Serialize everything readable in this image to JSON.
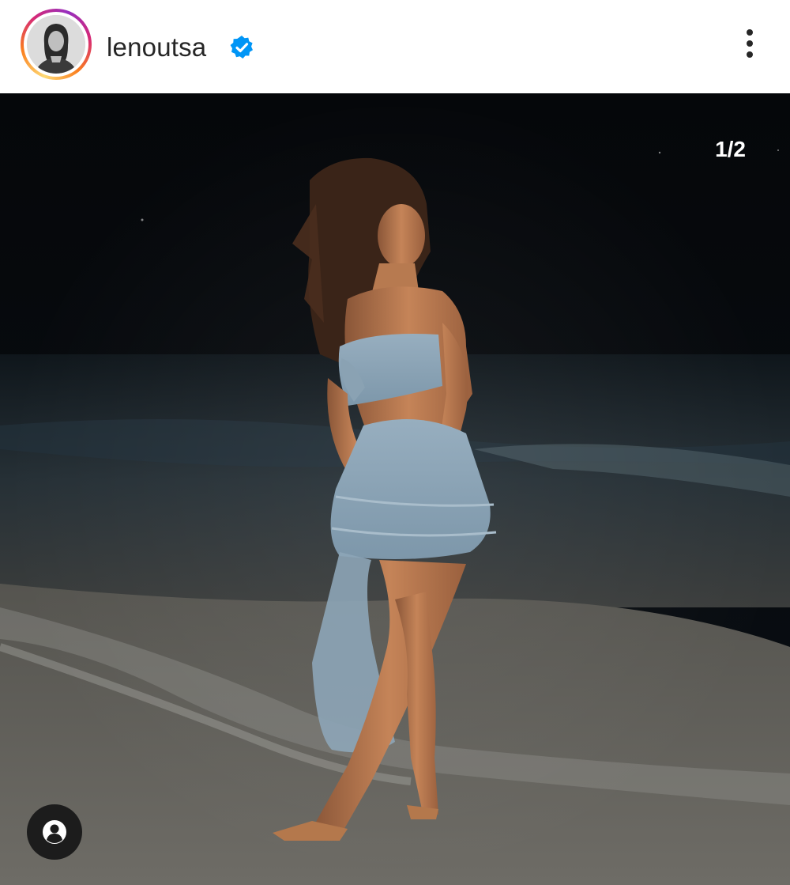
{
  "post": {
    "username": "lenoutsa",
    "verified": true,
    "carousel_counter": "1/2"
  },
  "icons": {
    "verified": "verified-badge-icon",
    "more": "more-options-icon",
    "tags": "user-tags-icon"
  },
  "colors": {
    "verified_badge": "#0095f6",
    "text": "#262626",
    "photo_background": "#05070a"
  }
}
